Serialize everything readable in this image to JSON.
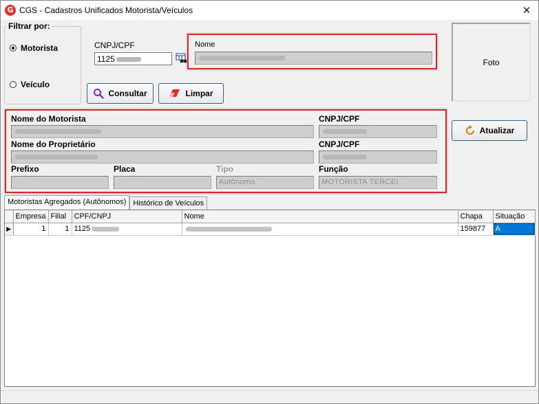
{
  "window": {
    "title": "CGS - Cadastros Unificados Motorista/Veículos",
    "app_icon_letter": "G",
    "close_glyph": "✕"
  },
  "filter": {
    "legend": "Filtrar por:",
    "options": [
      {
        "label": "Motorista",
        "selected": true
      },
      {
        "label": "Veículo",
        "selected": false
      }
    ]
  },
  "search": {
    "cnpj_label": "CNPJ/CPF",
    "cnpj_value": "1125",
    "nome_label": "Nome",
    "nome_value": ""
  },
  "buttons": {
    "consultar": "Consultar",
    "limpar": "Limpar",
    "atualizar": "Atualizar"
  },
  "photo": {
    "label": "Foto"
  },
  "details": {
    "nome_motorista_label": "Nome do Motorista",
    "cnpj_cpf_label_1": "CNPJ/CPF",
    "nome_proprietario_label": "Nome do Proprietário",
    "cnpj_cpf_label_2": "CNPJ/CPF",
    "prefixo_label": "Prefixo",
    "placa_label": "Placa",
    "tipo_label": "Tipo",
    "tipo_value": "Autônomo",
    "funcao_label": "Função",
    "funcao_value": "MOTORISTA TERCEI"
  },
  "tabs": [
    {
      "label": "Motoristas Agregados (Autônomos)",
      "active": true
    },
    {
      "label": "Histórico de Veículos",
      "active": false
    }
  ],
  "grid": {
    "columns": [
      "Empresa",
      "Filial",
      "CPF/CNPJ",
      "Nome",
      "Chapa",
      "Situação"
    ],
    "rows": [
      {
        "indicator": "▶",
        "empresa": "1",
        "filial": "1",
        "cpf": "1125",
        "nome": "",
        "chapa": "159877",
        "situacao": "A"
      }
    ]
  },
  "colors": {
    "highlight_red": "#d02a2a",
    "selection_blue": "#0078d7"
  }
}
